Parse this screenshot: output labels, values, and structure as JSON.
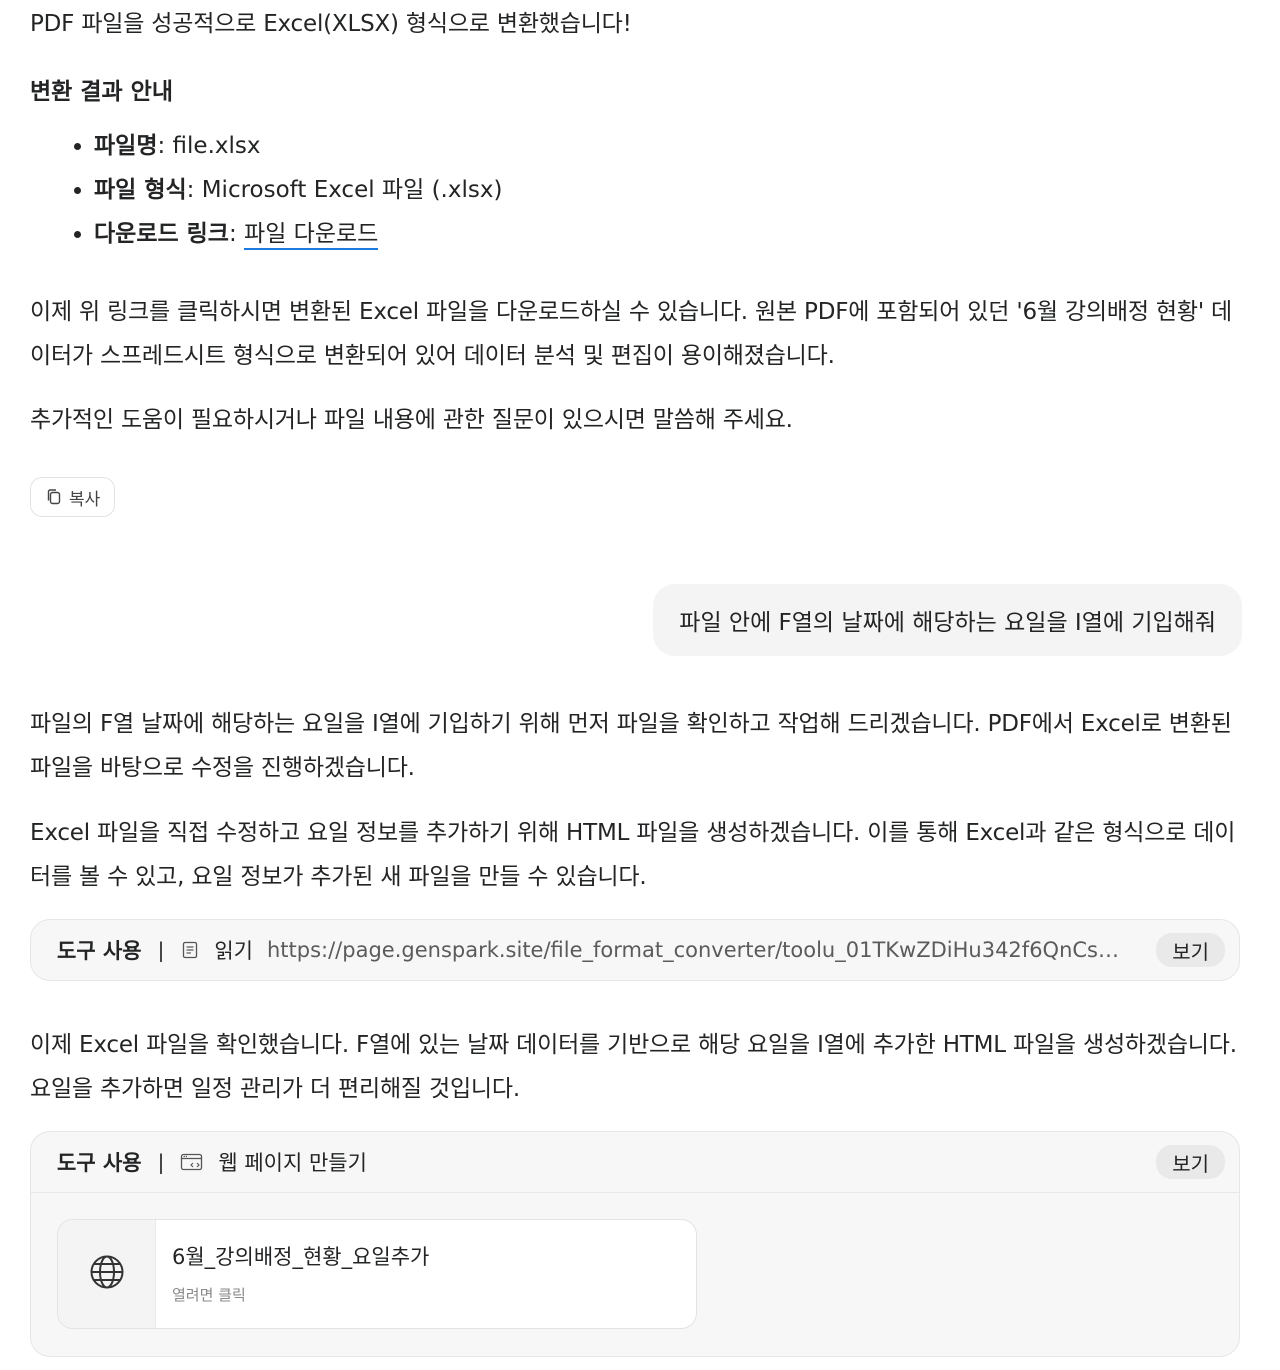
{
  "messages": {
    "intro": "PDF 파일을 성공적으로 Excel(XLSX) 형식으로 변환했습니다!",
    "result_heading": "변환 결과 안내",
    "result_items": [
      {
        "label": "파일명",
        "value": ": file.xlsx"
      },
      {
        "label": "파일 형식",
        "value": ": Microsoft Excel 파일 (.xlsx)"
      },
      {
        "label": "다운로드 링크",
        "sep": ": ",
        "link": "파일 다운로드"
      }
    ],
    "para1": "이제 위 링크를 클릭하시면 변환된 Excel 파일을 다운로드하실 수 있습니다. 원본 PDF에 포함되어 있던 '6월 강의배정 현황' 데이터가 스프레드시트 형식으로 변환되어 있어 데이터 분석 및 편집이 용이해졌습니다.",
    "para2": "추가적인 도움이 필요하시거나 파일 내용에 관한 질문이 있으시면 말씀해 주세요.",
    "copy_label": "복사",
    "user_message": "파일 안에 F열의 날짜에 해당하는 요일을 I열에 기입해줘",
    "para3": "파일의 F열 날짜에 해당하는 요일을 I열에 기입하기 위해 먼저 파일을 확인하고 작업해 드리겠습니다. PDF에서 Excel로 변환된 파일을 바탕으로 수정을 진행하겠습니다.",
    "para4": "Excel 파일을 직접 수정하고 요일 정보를 추가하기 위해 HTML 파일을 생성하겠습니다. 이를 통해 Excel과 같은 형식으로 데이터를 볼 수 있고, 요일 정보가 추가된 새 파일을 만들 수 있습니다.",
    "para5": "이제 Excel 파일을 확인했습니다. F열에 있는 날짜 데이터를 기반으로 해당 요일을 I열에 추가한 HTML 파일을 생성하겠습니다. 요일을 추가하면 일정 관리가 더 편리해질 것입니다."
  },
  "tool1": {
    "label": "도구 사용",
    "separator": "|",
    "icon": "document-icon",
    "action": "읽기",
    "url": "https://page.genspark.site/file_format_converter/toolu_01TKwZDiHu342f6QnCsMt...",
    "view_label": "보기"
  },
  "tool2": {
    "label": "도구 사용",
    "separator": "|",
    "icon": "webpage-icon",
    "action": "웹 페이지 만들기",
    "view_label": "보기",
    "card": {
      "title": "6월_강의배정_현황_요일추가",
      "subtitle": "열려면 클릭",
      "icon": "globe-icon"
    }
  }
}
